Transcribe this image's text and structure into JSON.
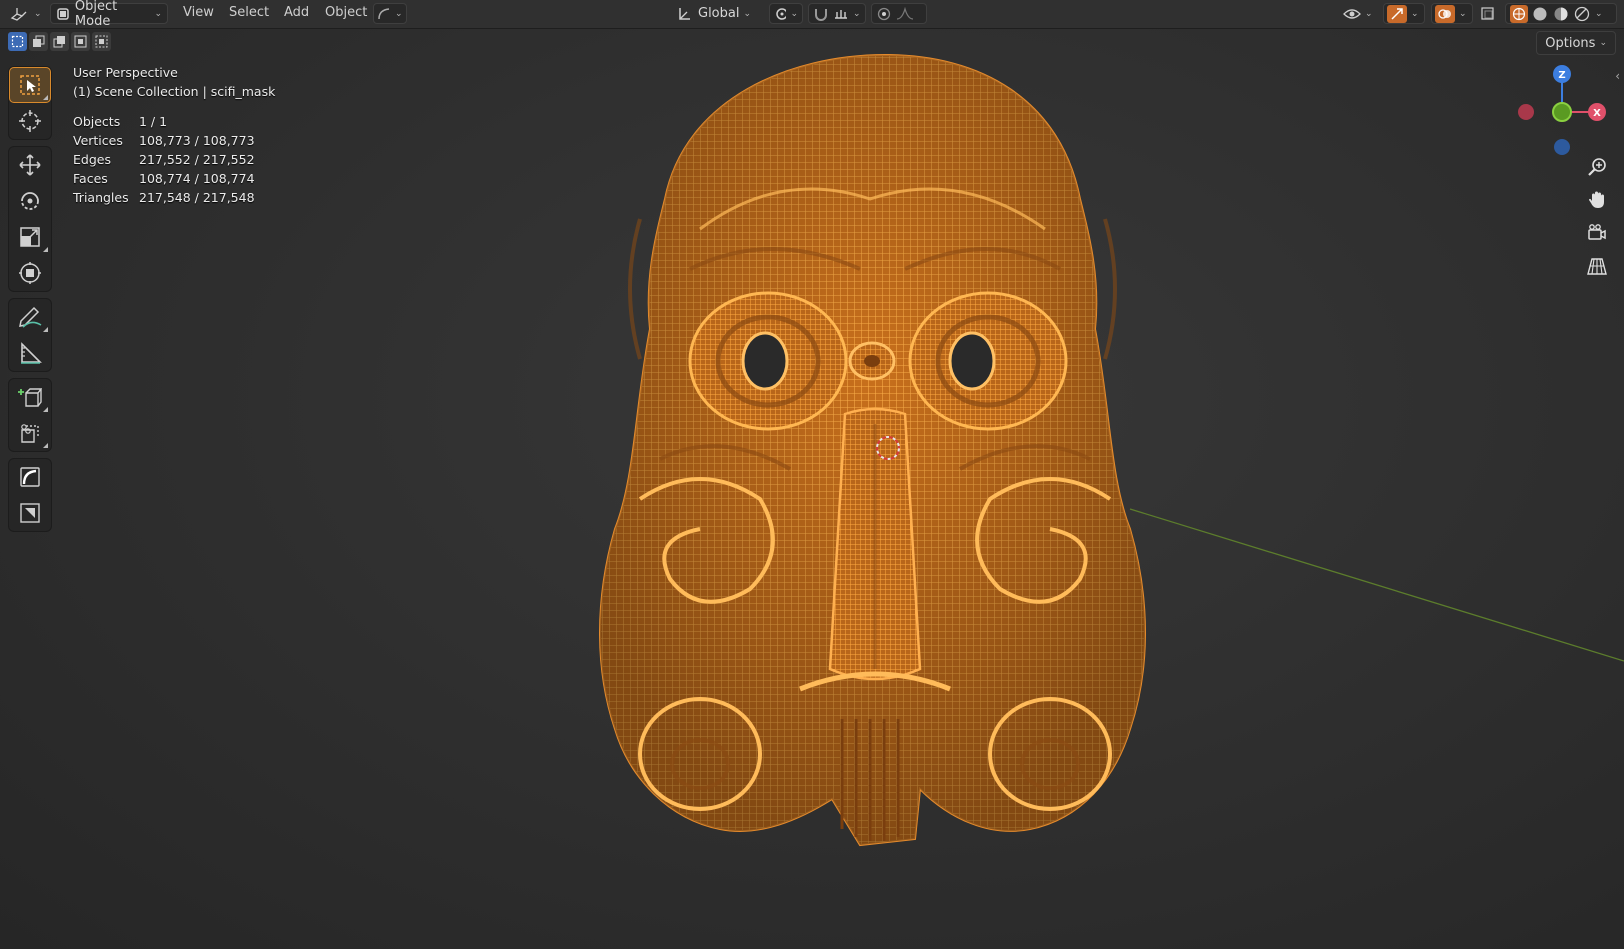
{
  "header": {
    "editor_type_icon": "3d-viewport-icon",
    "mode": "Object Mode",
    "menus": [
      "View",
      "Select",
      "Add",
      "Object"
    ],
    "transform_orientation": "Global",
    "options_label": "Options"
  },
  "viewport": {
    "view_name": "User Perspective",
    "collection_line": "(1) Scene Collection | scifi_mask",
    "stats": [
      {
        "label": "Objects",
        "value": "1 / 1"
      },
      {
        "label": "Vertices",
        "value": "108,773 / 108,773"
      },
      {
        "label": "Edges",
        "value": "217,552 / 217,552"
      },
      {
        "label": "Faces",
        "value": "108,774 / 108,774"
      },
      {
        "label": "Triangles",
        "value": "217,548 / 217,548"
      }
    ],
    "gizmo_axes": [
      "Z",
      "X"
    ]
  },
  "toolbar": {
    "tools": [
      {
        "name": "select-box-tool",
        "icon": "select-cursor-icon",
        "active": true
      },
      {
        "name": "cursor-tool",
        "icon": "cursor-crosshair-icon",
        "active": false
      },
      {
        "name": "move-tool",
        "icon": "move-arrows-icon",
        "active": false
      },
      {
        "name": "rotate-tool",
        "icon": "rotate-icon",
        "active": false
      },
      {
        "name": "scale-tool",
        "icon": "scale-icon",
        "active": false
      },
      {
        "name": "transform-tool",
        "icon": "transform-icon",
        "active": false
      },
      {
        "name": "annotate-tool",
        "icon": "pencil-icon",
        "active": false
      },
      {
        "name": "measure-tool",
        "icon": "ruler-icon",
        "active": false
      },
      {
        "name": "add-cube-tool",
        "icon": "add-cube-icon",
        "active": false
      },
      {
        "name": "shear-tool",
        "icon": "shear-icon",
        "active": false
      },
      {
        "name": "curve-tool",
        "icon": "curve-icon",
        "active": false
      },
      {
        "name": "image-tool",
        "icon": "image-icon",
        "active": false
      }
    ]
  },
  "colors": {
    "accent": "#e8912a",
    "mesh": "#f2a03a",
    "background": "#2c2c2c",
    "axis_x": "#e0506a",
    "axis_y": "#7ab830",
    "axis_z": "#3c7ee0"
  }
}
